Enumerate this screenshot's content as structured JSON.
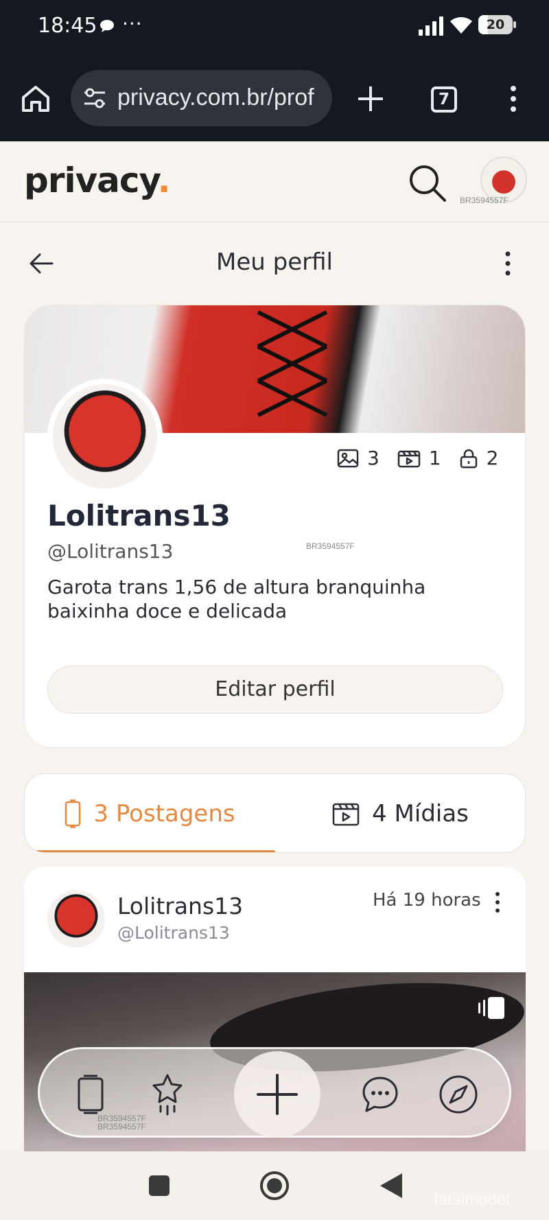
{
  "status_bar": {
    "time": "18:45",
    "overflow": "···",
    "battery": "20"
  },
  "browser": {
    "url": "privacy.com.br/prof",
    "tab_count": "7"
  },
  "site": {
    "logo_text": "privacy",
    "logo_dot": ".",
    "watermark": "BR3594557F"
  },
  "profile_nav": {
    "title": "Meu perfil"
  },
  "profile": {
    "name": "Lolitrans13",
    "handle": "@Lolitrans13",
    "bio": "Garota trans 1,56 de altura branquinha baixinha doce e delicada",
    "edit_label": "Editar perfil",
    "stats": {
      "images": "3",
      "videos": "1",
      "locked": "2"
    },
    "watermark": "BR3594557F"
  },
  "tabs": [
    {
      "label": "3 Postagens",
      "active": true
    },
    {
      "label": "4 Mídias",
      "active": false
    }
  ],
  "post": {
    "name": "Lolitrans13",
    "handle": "@Lolitrans13",
    "time": "Há 19 horas"
  },
  "float_nav": {
    "watermark1": "BR3594557F",
    "watermark2": "BR3594557F"
  },
  "brand_overlay": "fatalmodel",
  "colors": {
    "accent": "#e4893f",
    "dark_chrome": "#141820",
    "page_bg": "#f7f4ef"
  },
  "icons": [
    "home-icon",
    "tune-icon",
    "plus-icon",
    "tabs-icon",
    "more-vert-icon",
    "search-icon",
    "back-arrow-icon",
    "image-icon",
    "video-icon",
    "lock-icon",
    "phone-icon",
    "clapper-icon",
    "gallery-icon",
    "star-icon",
    "chat-icon",
    "compass-icon",
    "square-icon",
    "circle-icon",
    "triangle-back-icon"
  ]
}
